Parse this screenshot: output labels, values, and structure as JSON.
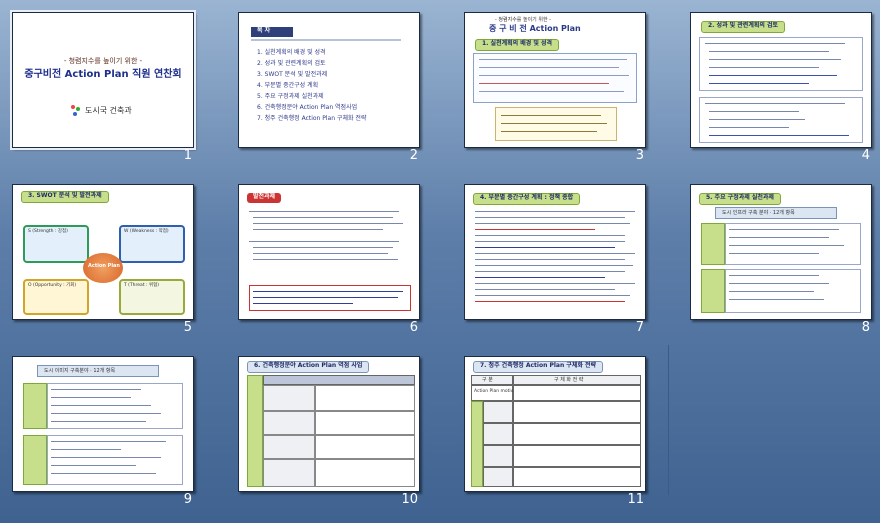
{
  "slides": [
    {
      "number": "1",
      "subtitle": "- 청렴지수를 높이기 위한 -",
      "title": "중구비전 Action Plan 직원 연찬회",
      "org": "도시국 건축과"
    },
    {
      "number": "2",
      "header": "목 차",
      "items": [
        "1. 실천계획의 배경 및 성격",
        "2. 성과 및 관련계획의 검토",
        "3. SWOT 분석 및 발전과제",
        "4. 부문별 중간구성 계획",
        "5. 주요 구정과제 실천과제",
        "6. 건축행정분야 Action Plan 역점사업",
        "7. 청주 건축행정 Action Plan 구체화 전략"
      ]
    },
    {
      "number": "3",
      "kicker": "- 청렴지수를 높이기 위한 -",
      "title": "중 구 비 전  Action Plan",
      "section": "1. 실천계획의 배경 및 성격"
    },
    {
      "number": "4",
      "section": "2. 성과 및 관련계획의 검토"
    },
    {
      "number": "5",
      "section": "3. SWOT 분석 및 발전과제",
      "center": "Action Plan",
      "quadrants": [
        "S (Strength : 강점)",
        "W (Weakness : 약점)",
        "O (Opportunity : 기회)",
        "T (Threat : 위협)"
      ]
    },
    {
      "number": "6",
      "section": "발전과제"
    },
    {
      "number": "7",
      "section": "4. 부문별 중간구성 계획 : 정책 종합"
    },
    {
      "number": "8",
      "section": "5. 주요 구정과제 실천과제",
      "subsection": "도시 인프라 구축 분야 · 12개 항목"
    },
    {
      "number": "9",
      "subsection": "도시 이미지 구축분야 · 12개 항목"
    },
    {
      "number": "10",
      "section": "6. 건축행정분야 Action Plan 역점 사업"
    },
    {
      "number": "11",
      "section": "7. 청주 건축행정 Action Plan 구체화 전략",
      "col_a": "구 분",
      "col_b": "구 체 화 전 략",
      "row_head": "Action Plan motive"
    }
  ],
  "colors": {
    "background": "#5d7ea9",
    "title_blue": "#1f2f8c",
    "accent_green": "#c7df8a"
  }
}
